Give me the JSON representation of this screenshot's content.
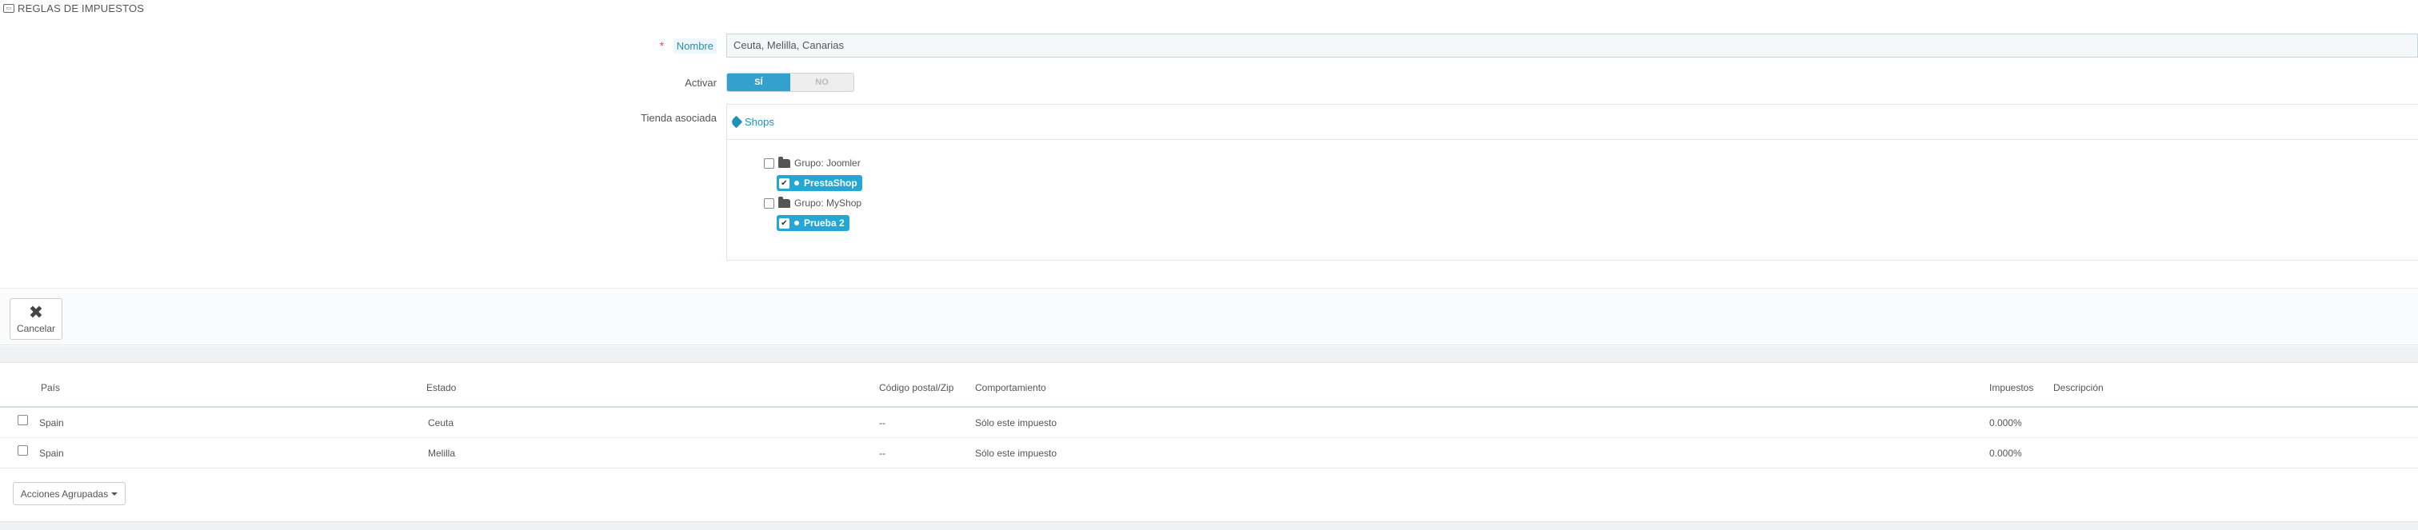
{
  "panel": {
    "title": "REGLAS DE IMPUESTOS",
    "icon": "tax-rules-icon"
  },
  "form": {
    "name_required_mark": "*",
    "name_label": "Nombre",
    "name_value": "Ceuta, Melilla, Canarias",
    "active_label": "Activar",
    "active_yes": "SÍ",
    "active_no": "NO",
    "active_selected": "yes",
    "shop_label": "Tienda asociada",
    "shops_header": "Shops",
    "tree": [
      {
        "label": "Grupo: Joomler",
        "checked": false,
        "shops": [
          {
            "label": "PrestaShop",
            "checked": true
          }
        ]
      },
      {
        "label": "Grupo: MyShop",
        "checked": false,
        "shops": [
          {
            "label": "Prueba 2",
            "checked": true
          }
        ]
      }
    ]
  },
  "footer": {
    "cancel_label": "Cancelar"
  },
  "table": {
    "headers": {
      "country": "País",
      "state": "Estado",
      "zip": "Código postal/Zip",
      "behavior": "Comportamiento",
      "tax": "Impuestos",
      "description": "Descripción"
    },
    "rows": [
      {
        "country": "Spain",
        "state": "Ceuta",
        "zip": "--",
        "behavior": "Sólo este impuesto",
        "tax": "0.000%",
        "description": ""
      },
      {
        "country": "Spain",
        "state": "Melilla",
        "zip": "--",
        "behavior": "Sólo este impuesto",
        "tax": "0.000%",
        "description": ""
      }
    ],
    "bulk_actions_label": "Acciones Agrupadas"
  },
  "colors": {
    "accent": "#25a7d6",
    "required": "#e84e4e",
    "link": "#2290b6"
  }
}
